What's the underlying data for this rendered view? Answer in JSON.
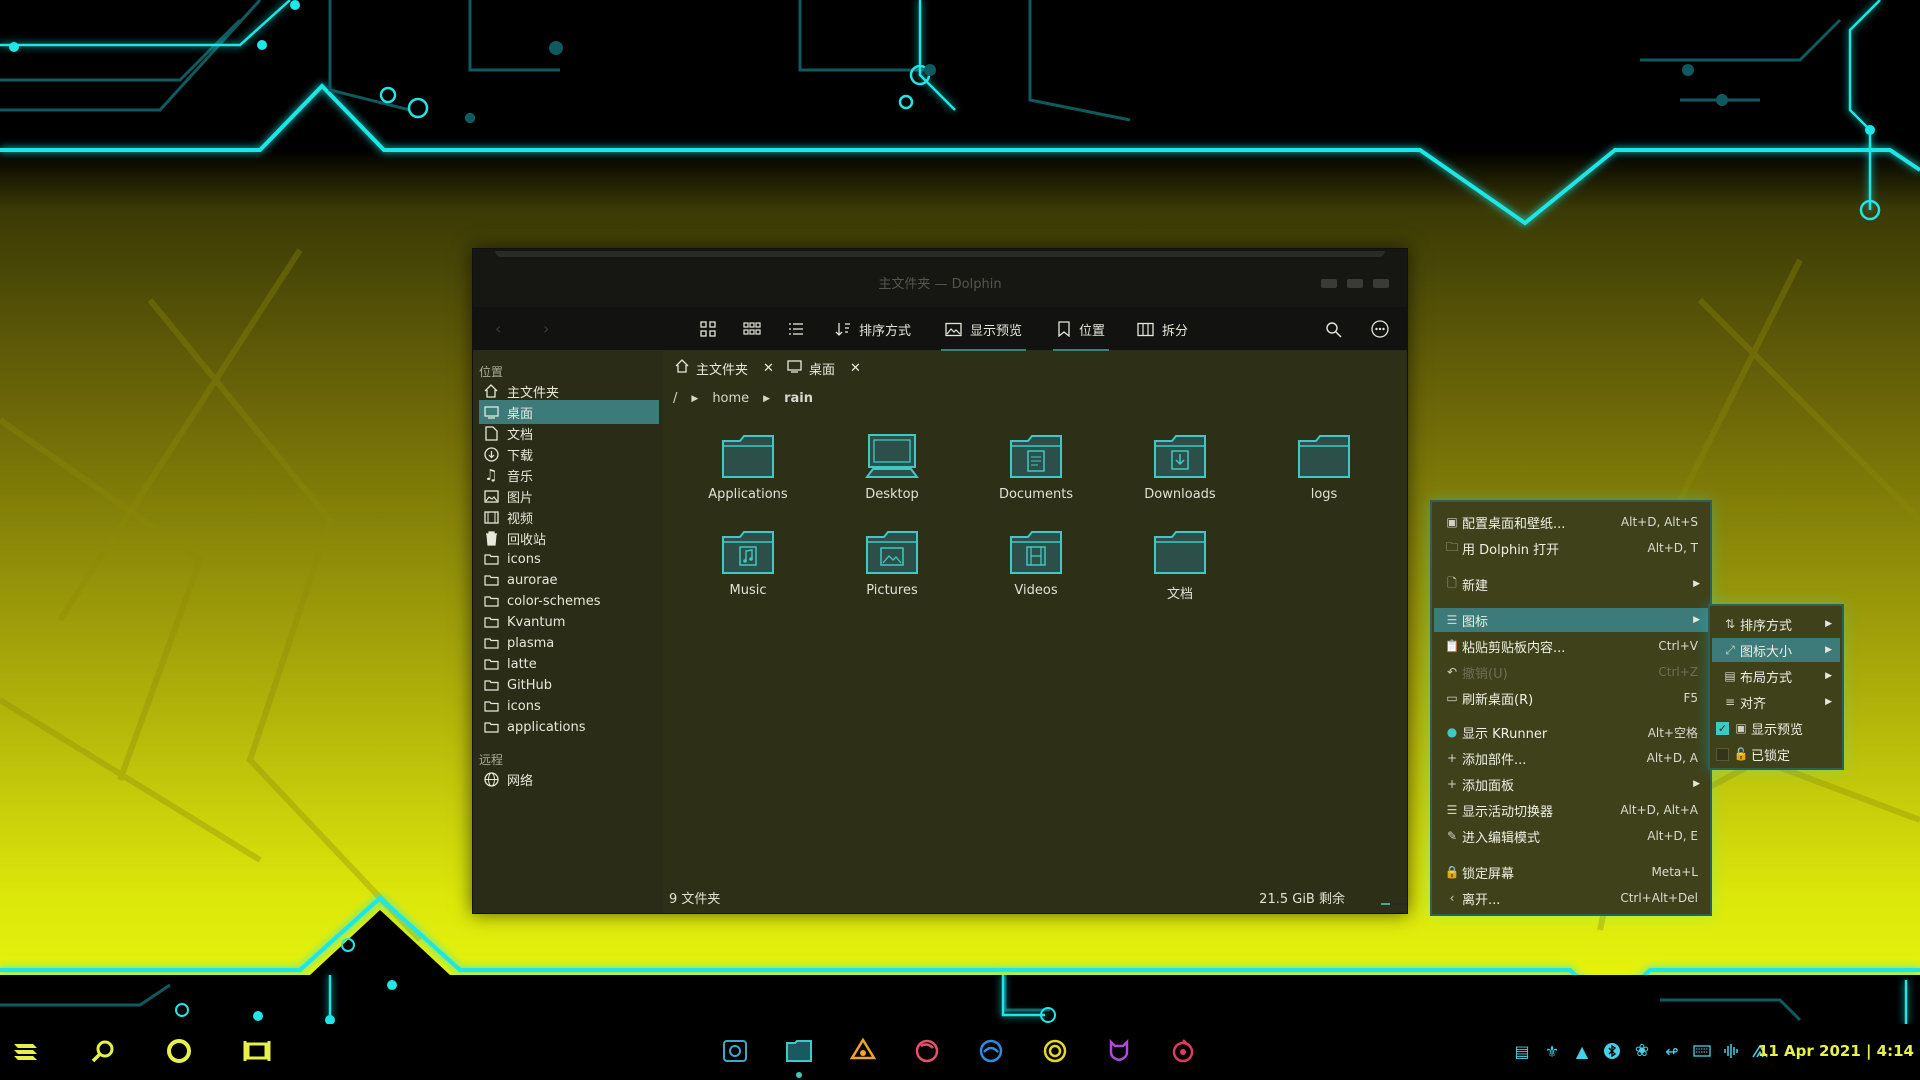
{
  "window": {
    "title": "主文件夹 — Dolphin",
    "toolbar": {
      "sort_label": "排序方式",
      "preview_label": "显示预览",
      "places_label": "位置",
      "split_label": "拆分"
    },
    "sidebar": {
      "places_header": "位置",
      "places": [
        {
          "label": "主文件夹",
          "icon": "home-icon"
        },
        {
          "label": "桌面",
          "icon": "desktop-icon",
          "selected": true
        },
        {
          "label": "文档",
          "icon": "document-icon"
        },
        {
          "label": "下载",
          "icon": "download-icon"
        },
        {
          "label": "音乐",
          "icon": "music-icon"
        },
        {
          "label": "图片",
          "icon": "image-icon"
        },
        {
          "label": "视频",
          "icon": "video-icon"
        },
        {
          "label": "回收站",
          "icon": "trash-icon"
        },
        {
          "label": "icons",
          "icon": "folder-icon"
        },
        {
          "label": "aurorae",
          "icon": "folder-icon"
        },
        {
          "label": "color-schemes",
          "icon": "folder-icon"
        },
        {
          "label": "Kvantum",
          "icon": "folder-icon"
        },
        {
          "label": "plasma",
          "icon": "folder-icon"
        },
        {
          "label": "latte",
          "icon": "folder-icon"
        },
        {
          "label": "GitHub",
          "icon": "folder-icon"
        },
        {
          "label": "icons",
          "icon": "folder-icon"
        },
        {
          "label": "applications",
          "icon": "folder-icon"
        }
      ],
      "remote_header": "远程",
      "remote": [
        {
          "label": "网络",
          "icon": "network-icon"
        }
      ]
    },
    "tabs": [
      {
        "label": "主文件夹",
        "icon": "home-icon"
      },
      {
        "label": "桌面",
        "icon": "desktop-icon"
      }
    ],
    "breadcrumb": {
      "root": "/",
      "parts": [
        "home",
        "rain"
      ]
    },
    "files": [
      {
        "name": "Applications",
        "icon": "folder-icon"
      },
      {
        "name": "Desktop",
        "icon": "desktop-folder-icon"
      },
      {
        "name": "Documents",
        "icon": "documents-folder-icon"
      },
      {
        "name": "Downloads",
        "icon": "downloads-folder-icon"
      },
      {
        "name": "logs",
        "icon": "folder-icon"
      },
      {
        "name": "Music",
        "icon": "music-folder-icon"
      },
      {
        "name": "Pictures",
        "icon": "pictures-folder-icon"
      },
      {
        "name": "Videos",
        "icon": "videos-folder-icon"
      },
      {
        "name": "文档",
        "icon": "folder-icon"
      }
    ],
    "status": {
      "count": "9 文件夹",
      "free": "21.5 GiB 剩余",
      "free_fraction": 0.35
    }
  },
  "context_menu": {
    "items": [
      {
        "label": "配置桌面和壁纸...",
        "shortcut": "Alt+D, Alt+S",
        "icon": "configure-desktop-icon"
      },
      {
        "label": "用 Dolphin 打开",
        "shortcut": "Alt+D, T",
        "icon": "folder-open-icon"
      },
      {
        "label": "新建",
        "shortcut": "",
        "icon": "new-file-icon"
      },
      {
        "label": "图标",
        "shortcut": "",
        "icon": "icons-icon"
      },
      {
        "label": "粘贴剪贴板内容...",
        "shortcut": "Ctrl+V",
        "icon": "paste-icon"
      },
      {
        "label": "撤销(U)",
        "shortcut": "Ctrl+Z",
        "icon": "undo-icon"
      },
      {
        "label": "刷新桌面(R)",
        "shortcut": "F5",
        "icon": "refresh-icon"
      },
      {
        "label": "显示 KRunner",
        "shortcut": "Alt+空格",
        "icon": "krunner-icon"
      },
      {
        "label": "添加部件...",
        "shortcut": "Alt+D, A",
        "icon": "add-icon"
      },
      {
        "label": "添加面板",
        "shortcut": "",
        "icon": "add-icon"
      },
      {
        "label": "显示活动切换器",
        "shortcut": "Alt+D, Alt+A",
        "icon": "activities-icon"
      },
      {
        "label": "进入编辑模式",
        "shortcut": "Alt+D, E",
        "icon": "edit-icon"
      },
      {
        "label": "锁定屏幕",
        "shortcut": "Meta+L",
        "icon": "lock-icon"
      },
      {
        "label": "离开...",
        "shortcut": "Ctrl+Alt+Del",
        "icon": "leave-icon"
      }
    ],
    "submenu": [
      {
        "label": "排序方式",
        "icon": "sort-icon"
      },
      {
        "label": "图标大小",
        "icon": "icon-size-icon"
      },
      {
        "label": "布局方式",
        "icon": "layout-icon"
      },
      {
        "label": "对齐",
        "icon": "align-icon"
      },
      {
        "label": "显示预览",
        "icon": "preview-icon",
        "checked": true
      },
      {
        "label": "已锁定",
        "icon": "lock-icon",
        "checked": false
      }
    ]
  },
  "taskbar": {
    "clock": "11 Apr 2021 | 4:14"
  },
  "colors": {
    "accent": "#3c7b79",
    "neon": "#1fe7e7",
    "clock": "#e6f14a"
  }
}
